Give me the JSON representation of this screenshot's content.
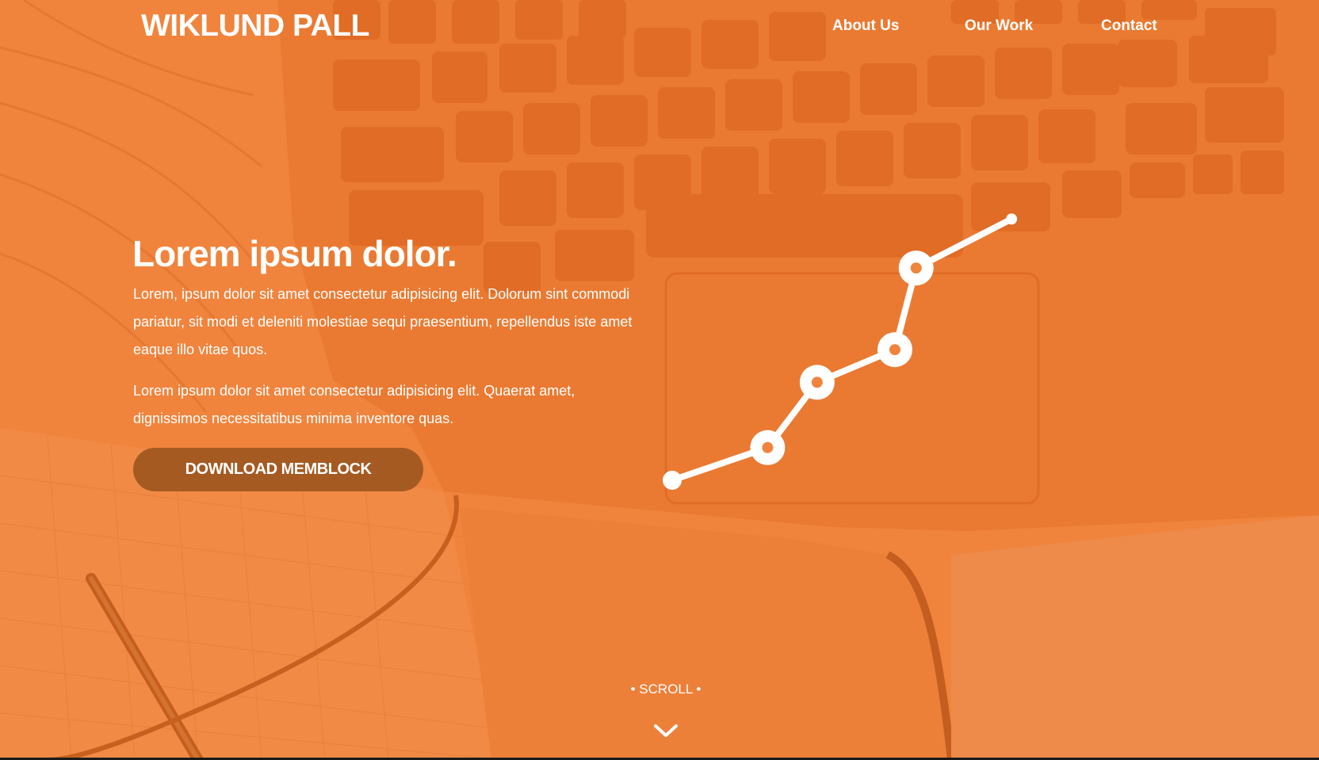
{
  "header": {
    "brand": "WIKLUND PALL",
    "nav": [
      {
        "label": "About Us"
      },
      {
        "label": "Our Work"
      },
      {
        "label": "Contact"
      }
    ]
  },
  "hero": {
    "headline": "Lorem ipsum dolor.",
    "paragraph_1": "Lorem, ipsum dolor sit amet consectetur adipisicing elit. Dolorum sint commodi pariatur, sit modi et deleniti molestiae sequi praesentium, repellendus iste amet eaque illo vitae quos.",
    "paragraph_2": "Lorem ipsum dolor sit amet consectetur adipisicing elit. Quaerat amet, dignissimos necessitatibus minima inventore quas.",
    "cta_label": "DOWNLOAD MEMBLOCK"
  },
  "scroll": {
    "label": "• SCROLL •",
    "icon": "chevron-down-icon"
  },
  "chart_data": {
    "type": "line",
    "x": [
      1,
      2,
      3,
      4,
      5,
      6
    ],
    "values": [
      0.0,
      0.1,
      0.3,
      0.4,
      0.65,
      0.8
    ],
    "ylim": [
      0,
      1
    ],
    "grid": false
  },
  "colors": {
    "background": "#f0843d",
    "overlay_dark": "#d96a27",
    "button": "#a55a22",
    "text": "#ffffff"
  }
}
